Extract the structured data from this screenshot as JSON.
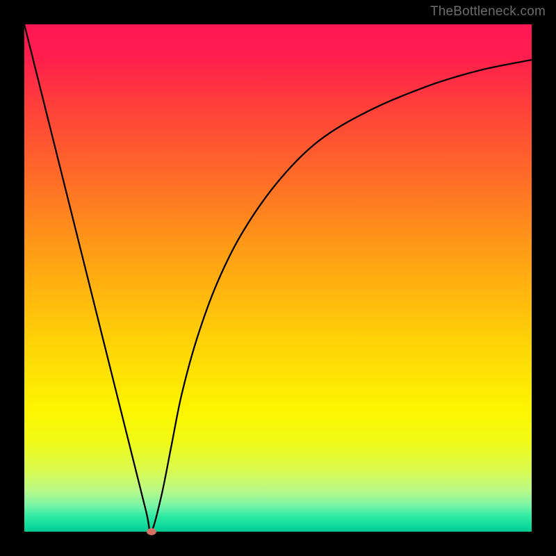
{
  "attribution": "TheBottleneck.com",
  "colors": {
    "curve": "#000000",
    "dot": "#d47268",
    "frame": "#000000"
  },
  "chart_data": {
    "type": "line",
    "title": "",
    "xlabel": "",
    "ylabel": "",
    "xlim": [
      0,
      100
    ],
    "ylim": [
      0,
      100
    ],
    "grid": false,
    "legend": false,
    "series": [
      {
        "name": "bottleneck-curve",
        "x": [
          0,
          4,
          8,
          12,
          16,
          20,
          24,
          25,
          27,
          29,
          31,
          34,
          38,
          43,
          50,
          58,
          68,
          80,
          90,
          100
        ],
        "values": [
          100,
          84,
          68,
          52,
          36,
          20,
          4,
          0,
          7,
          17,
          27,
          38,
          49,
          59,
          69,
          77,
          83,
          88,
          91,
          93
        ]
      }
    ],
    "markers": [
      {
        "name": "min-point",
        "x": 25,
        "y": 0
      }
    ],
    "background_gradient": {
      "orientation": "vertical",
      "stops": [
        {
          "pos": 0.0,
          "color": "#ff1752"
        },
        {
          "pos": 0.3,
          "color": "#ff6b28"
        },
        {
          "pos": 0.62,
          "color": "#ffd107"
        },
        {
          "pos": 0.82,
          "color": "#f0fa14"
        },
        {
          "pos": 1.0,
          "color": "#05c890"
        }
      ]
    }
  }
}
